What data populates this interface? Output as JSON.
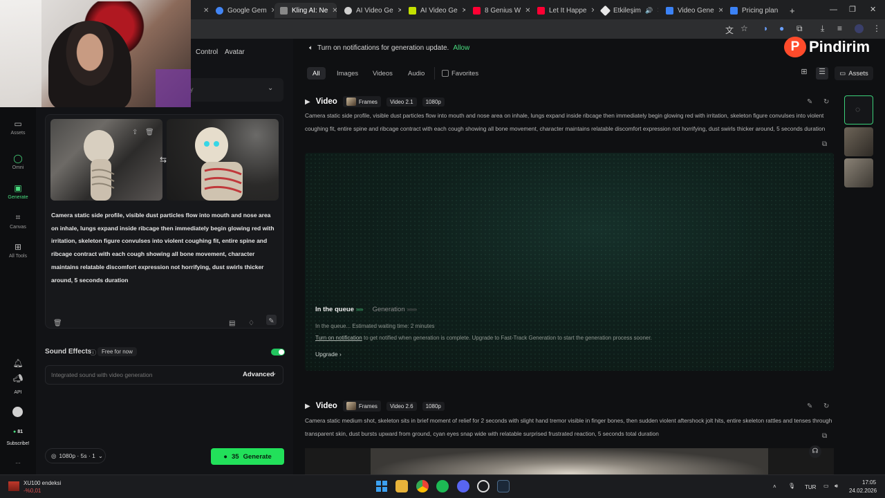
{
  "browser": {
    "tabs": [
      {
        "label": "Google Gem",
        "color": "#4285f4"
      },
      {
        "label": "Kling AI: Ne",
        "color": "#9aa0a6"
      },
      {
        "label": "AI Video Ge",
        "color": "#cfcfcf"
      },
      {
        "label": "AI Video Ge",
        "color": "#c4e100"
      },
      {
        "label": "8 Genius W",
        "color": "#ff0033"
      },
      {
        "label": "Let It Happe",
        "color": "#ff0033"
      },
      {
        "label": "Etkileşim",
        "color": "#e8e8e8"
      },
      {
        "label": "Video Gene",
        "color": "#3b82f6"
      },
      {
        "label": "Pricing plan",
        "color": "#3b82f6"
      }
    ],
    "new_tab": "+"
  },
  "app": {
    "top_links": [
      "Control",
      "Avatar"
    ],
    "dropdown_placeholder": "y",
    "rail": [
      {
        "label": "Assets",
        "icon": "folder-icon"
      },
      {
        "label": "Omni",
        "icon": "omni-icon"
      },
      {
        "label": "Generate",
        "icon": "generate-icon"
      },
      {
        "label": "Canvas",
        "icon": "canvas-icon"
      },
      {
        "label": "All Tools",
        "icon": "grid-icon"
      }
    ],
    "rail_bottom": {
      "api": "API",
      "credits": "81",
      "subscribe": "Subscribe!",
      "more": "..."
    },
    "prompt": "Camera static side profile, visible dust particles flow into mouth and nose area on inhale, lungs expand inside ribcage then immediately begin glowing red with irritation, skeleton figure convulses into violent coughing fit, entire spine and ribcage contract with each cough showing all bone movement, character maintains relatable discomfort expression not horrifying, dust swirls thicker around, 5 seconds duration",
    "sound_effects": {
      "title": "Sound Effects",
      "badge": "Free for now",
      "placeholder": "Integrated sound with video generation",
      "advanced": "Advanced"
    },
    "settings_pill": "1080p · 5s · 1",
    "generate": {
      "cost": "35",
      "label": "Generate"
    }
  },
  "main": {
    "notification": {
      "text": "Turn on notifications for generation update.",
      "allow": "Allow"
    },
    "logo": "Pindirim",
    "filters": [
      "All",
      "Images",
      "Videos",
      "Audio"
    ],
    "favorites": "Favorites",
    "assets": "Assets",
    "cards": [
      {
        "title": "Video",
        "frames": "Frames",
        "model": "Video 2.1",
        "res": "1080p",
        "desc": "Camera static side profile, visible dust particles flow into mouth and nose area on inhale, lungs expand inside ribcage then immediately begin glowing red with irritation, skeleton figure convulses into violent coughing fit, entire spine and ribcage contract with each cough showing all bone movement, character maintains relatable discomfort expression not horrifying, dust swirls thicker around, 5 seconds duration"
      },
      {
        "title": "Video",
        "frames": "Frames",
        "model": "Video 2.6",
        "res": "1080p",
        "desc": "Camera static medium shot, skeleton sits in brief moment of relief for 2 seconds with slight hand tremor visible in finger bones, then sudden violent aftershock jolt hits, entire skeleton rattles and tenses through transparent skin, dust bursts upward from ground, cyan eyes snap wide with relatable surprised frustrated reaction, 5 seconds total duration"
      }
    ],
    "queue": {
      "in_queue": "In the queue",
      "generation": "Generation",
      "wait": "In the queue... Estimated waiting time: 2 minutes",
      "notif_link": "Turn on notification",
      "notif_rest": " to get notified when generation is complete. Upgrade to Fast-Track Generation to start the generation process sooner.",
      "upgrade": "Upgrade"
    }
  },
  "taskbar": {
    "ticker_name": "XU100 endeksi",
    "ticker_value": "-%0,01",
    "lang": "TUR",
    "time": "17:05",
    "date": "24.02.2026"
  }
}
